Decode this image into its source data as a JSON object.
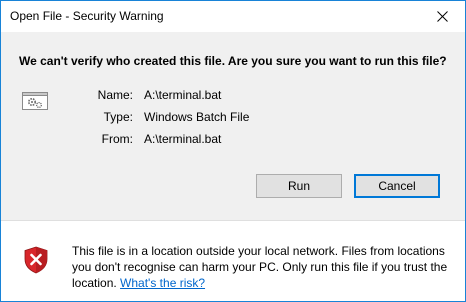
{
  "window": {
    "title": "Open File - Security Warning"
  },
  "dialog": {
    "headline": "We can't verify who created this file. Are you sure you want to run this file?",
    "file_icon": "batch-file-gear-icon",
    "properties": [
      {
        "label": "Name:",
        "value": "A:\\terminal.bat"
      },
      {
        "label": "Type:",
        "value": "Windows Batch File"
      },
      {
        "label": "From:",
        "value": "A:\\terminal.bat"
      }
    ],
    "buttons": {
      "run": "Run",
      "cancel": "Cancel"
    }
  },
  "footer": {
    "icon": "shield-error-icon",
    "warning_text": "This file is in a location outside your local network. Files from locations you don't recognise can harm your PC. Only run this file if you trust the location.",
    "link_text": "What's the risk?"
  },
  "colors": {
    "window_border": "#1883d7",
    "body_bg": "#f0f0f0",
    "link": "#0066cc",
    "shield_red": "#d8262b"
  }
}
